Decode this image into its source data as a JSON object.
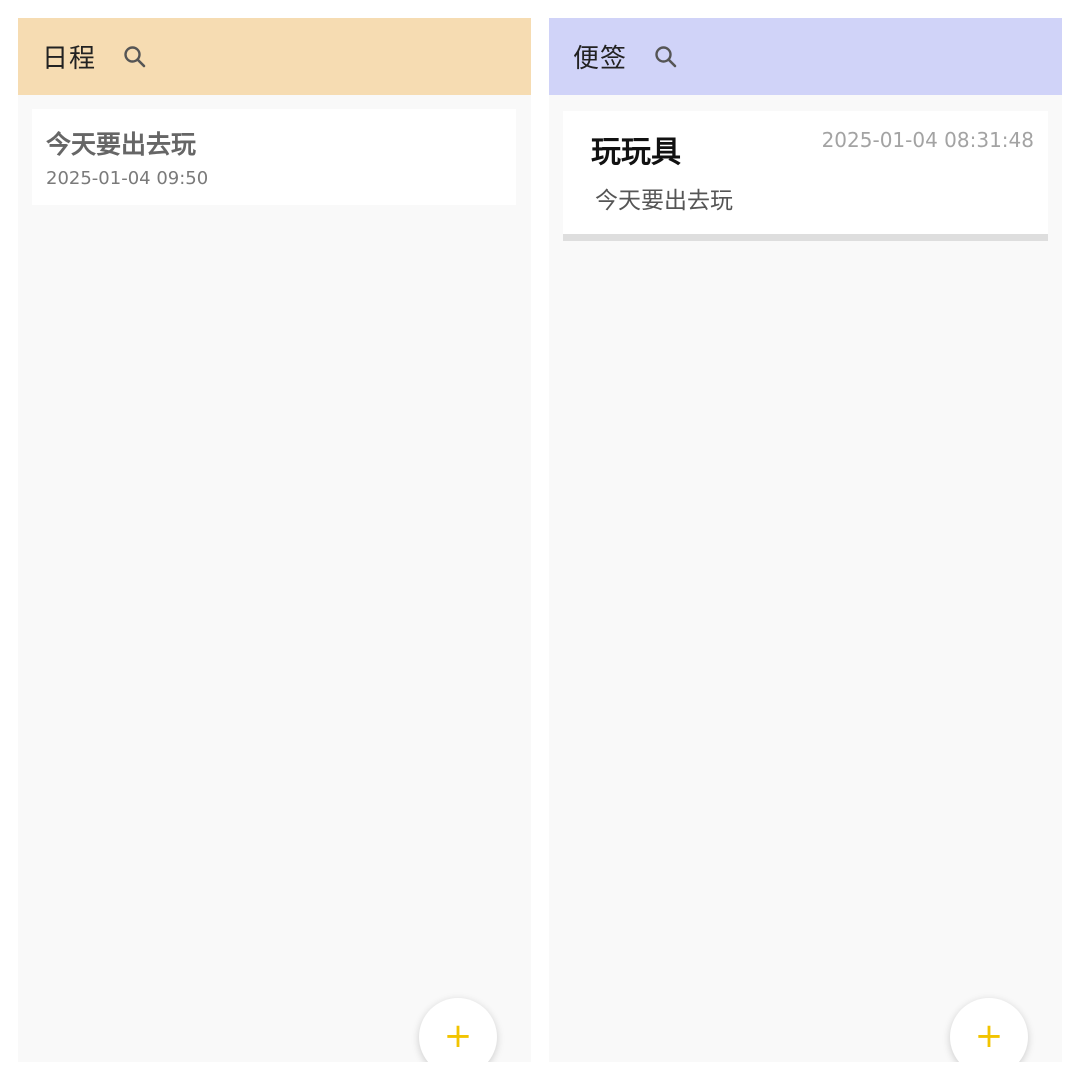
{
  "colors": {
    "schedule_header": "#f6dcb2",
    "notes_header": "#d0d3f8",
    "fab_plus": "#f2c400",
    "panel_bg": "#f9f9f9"
  },
  "schedule": {
    "header_title": "日程",
    "search_icon": "search-icon",
    "items": [
      {
        "title": "今天要出去玩",
        "time": "2025-01-04 09:50"
      }
    ],
    "fab_label": "+"
  },
  "notes": {
    "header_title": "便签",
    "search_icon": "search-icon",
    "items": [
      {
        "title": "玩玩具",
        "time": "2025-01-04 08:31:48",
        "body": "今天要出去玩"
      }
    ],
    "fab_label": "+"
  }
}
